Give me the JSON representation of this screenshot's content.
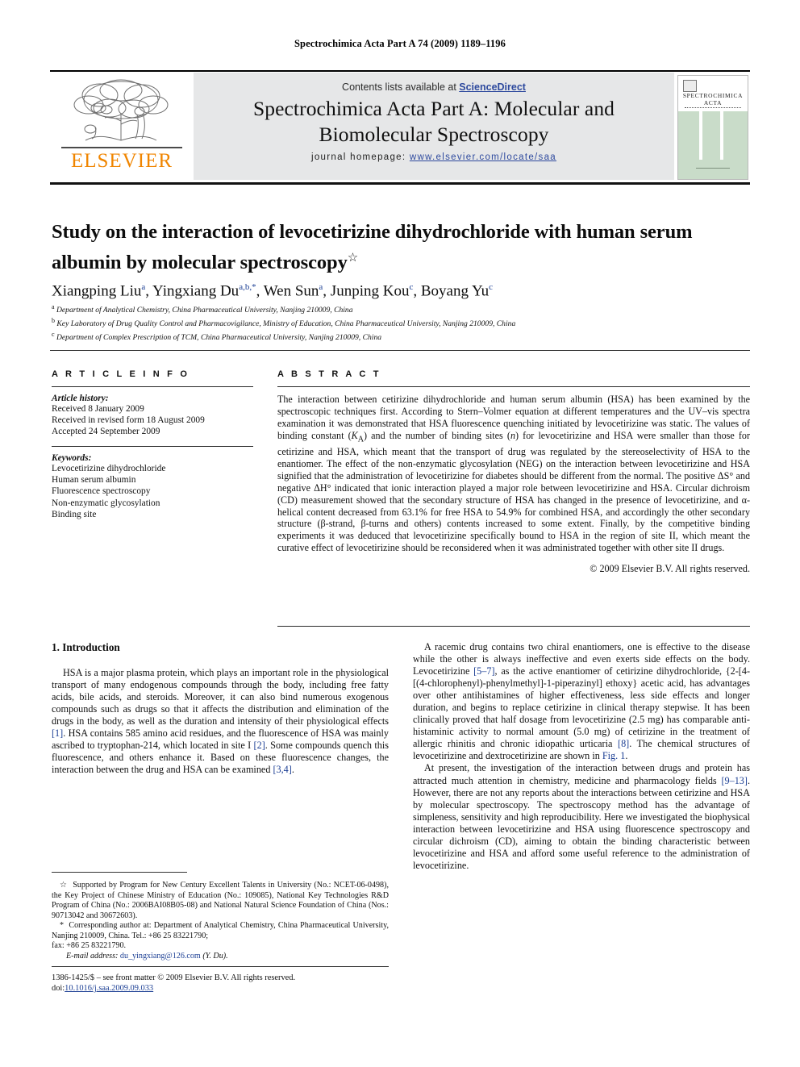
{
  "running_head": "Spectrochimica Acta Part A 74 (2009) 1189–1196",
  "masthead": {
    "contents_prefix": "Contents lists available at ",
    "sciencedirect": "ScienceDirect",
    "journal_title_line1": "Spectrochimica Acta Part A: Molecular and",
    "journal_title_line2": "Biomolecular Spectroscopy",
    "homepage_label": "journal homepage:",
    "homepage_url": "www.elsevier.com/locate/saa",
    "publisher_logo_text": "ELSEVIER",
    "cover_title_line1": "SPECTROCHIMICA",
    "cover_title_line2": "ACTA",
    "accent_link_color": "#2e4a9e",
    "logo_orange": "#f08500",
    "band_gray": "#e6e7e8",
    "cover_green": "#c9dcc9"
  },
  "article": {
    "title": "Study on the interaction of levocetirizine dihydrochloride with human serum albumin by molecular spectroscopy",
    "title_footnote_marker": "☆",
    "authors_html": "Xiangping Liu<sup>a</sup>, Yingxiang Du<sup>a,b,</sup><sup>*</sup>, Wen Sun<sup>a</sup>, Junping Kou<sup>c</sup>, Boyang Yu<sup>c</sup>",
    "affiliations": [
      {
        "marker": "a",
        "text": "Department of Analytical Chemistry, China Pharmaceutical University, Nanjing 210009, China"
      },
      {
        "marker": "b",
        "text": "Key Laboratory of Drug Quality Control and Pharmacovigilance, Ministry of Education, China Pharmaceutical University, Nanjing 210009, China"
      },
      {
        "marker": "c",
        "text": "Department of Complex Prescription of TCM, China Pharmaceutical University, Nanjing 210009, China"
      }
    ]
  },
  "article_info": {
    "heading": "A R T I C L E    I N F O",
    "history_heading": "Article history:",
    "history": [
      "Received 8 January 2009",
      "Received in revised form 18 August 2009",
      "Accepted 24 September 2009"
    ],
    "keywords_heading": "Keywords:",
    "keywords": [
      "Levocetirizine dihydrochloride",
      "Human serum albumin",
      "Fluorescence spectroscopy",
      "Non-enzymatic glycosylation",
      "Binding site"
    ]
  },
  "abstract": {
    "heading": "A B S T R A C T",
    "text": "The interaction between cetirizine dihydrochloride and human serum albumin (HSA) has been examined by the spectroscopic techniques first. According to Stern–Volmer equation at different temperatures and the UV–vis spectra examination it was demonstrated that HSA fluorescence quenching initiated by levocetirizine was static. The values of binding constant (KA) and the number of binding sites (n) for levocetirizine and HSA were smaller than those for cetirizine and HSA, which meant that the transport of drug was regulated by the stereoselectivity of HSA to the enantiomer. The effect of the non-enzymatic glycosylation (NEG) on the interaction between levocetirizine and HSA signified that the administration of levocetirizine for diabetes should be different from the normal. The positive ΔS° and negative ΔH° indicated that ionic interaction played a major role between levocetirizine and HSA. Circular dichroism (CD) measurement showed that the secondary structure of HSA has changed in the presence of levocetirizine, and α-helical content decreased from 63.1% for free HSA to 54.9% for combined HSA, and accordingly the other secondary structure (β-strand, β-turns and others) contents increased to some extent. Finally, by the competitive binding experiments it was deduced that levocetirizine specifically bound to HSA in the region of site II, which meant the curative effect of levocetirizine should be reconsidered when it was administrated together with other site II drugs.",
    "copyright": "© 2009 Elsevier B.V. All rights reserved."
  },
  "introduction": {
    "heading": "1.  Introduction",
    "left_paragraph": "HSA is a major plasma protein, which plays an important role in the physiological transport of many endogenous compounds through the body, including free fatty acids, bile acids, and steroids. Moreover, it can also bind numerous exogenous compounds such as drugs so that it affects the distribution and elimination of the drugs in the body, as well as the duration and intensity of their physiological effects [1]. HSA contains 585 amino acid residues, and the fluorescence of HSA was mainly ascribed to tryptophan-214, which located in site I [2]. Some compounds quench this fluorescence, and others enhance it. Based on these fluorescence changes, the interaction between the drug and HSA can be examined [3,4].",
    "right_paragraph_1": "A racemic drug contains two chiral enantiomers, one is effective to the disease while the other is always ineffective and even exerts side effects on the body. Levocetirizine [5–7], as the active enantiomer of cetirizine dihydrochloride, {2-[4-[(4-chlorophenyl)-phenylmethyl]-1-piperazinyl] ethoxy} acetic acid, has advantages over other antihistamines of higher effectiveness, less side effects and longer duration, and begins to replace cetirizine in clinical therapy stepwise. It has been clinically proved that half dosage from levocetirizine (2.5 mg) has comparable anti-histaminic activity to normal amount (5.0 mg) of cetirizine in the treatment of allergic rhinitis and chronic idiopathic urticaria [8]. The chemical structures of levocetirizine and dextrocetirizine are shown in Fig. 1.",
    "right_paragraph_2": "At present, the investigation of the interaction between drugs and protein has attracted much attention in chemistry, medicine and pharmacology fields [9–13]. However, there are not any reports about the interactions between cetirizine and HSA by molecular spectroscopy. The spectroscopy method has the advantage of simpleness, sensitivity and high reproducibility. Here we investigated the biophysical interaction between levocetirizine and HSA using fluorescence spectroscopy and circular dichroism (CD), aiming to obtain the binding characteristic between levocetirizine and HSA and afford some useful reference to the administration of levocetirizine."
  },
  "footnotes": {
    "funding": "Supported by Program for New Century Excellent Talents in University (No.: NCET-06-0498), the Key Project of Chinese Ministry of Education (No.: 109085), National Key Technologies R&D Program of China (No.: 2006BAI08B05-08) and National Natural Science Foundation of China (Nos.: 90713042 and 30672603).",
    "funding_marker": "☆",
    "corresponding_marker": "*",
    "corresponding": "Corresponding author at: Department of Analytical Chemistry, China Pharmaceutical University, Nanjing 210009, China. Tel.: +86 25 83221790;",
    "fax": "fax: +86 25 83221790.",
    "email_label": "E-mail address:",
    "email": "du_yingxiang@126.com",
    "email_owner": "(Y. Du)."
  },
  "footer": {
    "issn_line": "1386-1425/$ – see front matter © 2009 Elsevier B.V. All rights reserved.",
    "doi_label": "doi:",
    "doi": "10.1016/j.saa.2009.09.033"
  }
}
